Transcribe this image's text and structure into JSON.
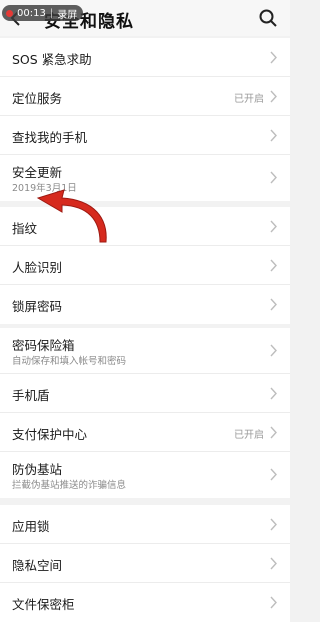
{
  "header": {
    "title": "安全和隐私",
    "status_time": "00:13",
    "status_label": "录屏"
  },
  "groups": [
    {
      "items": [
        {
          "label": "SOS 紧急求助"
        },
        {
          "label": "定位服务",
          "status": "已开启"
        },
        {
          "label": "查找我的手机"
        },
        {
          "label": "安全更新",
          "sub": "2019年3月1日"
        }
      ]
    },
    {
      "items": [
        {
          "label": "指纹"
        },
        {
          "label": "人脸识别"
        },
        {
          "label": "锁屏密码"
        }
      ]
    },
    {
      "items": [
        {
          "label": "密码保险箱",
          "sub": "自动保存和填入帐号和密码"
        },
        {
          "label": "手机盾"
        },
        {
          "label": "支付保护中心",
          "status": "已开启"
        },
        {
          "label": "防伪基站",
          "sub": "拦截伪基站推送的诈骗信息"
        }
      ]
    },
    {
      "items": [
        {
          "label": "应用锁"
        },
        {
          "label": "隐私空间"
        },
        {
          "label": "文件保密柜"
        }
      ]
    }
  ],
  "colors": {
    "accent_arrow": "#d62a1e",
    "background": "#f2f2f2"
  }
}
